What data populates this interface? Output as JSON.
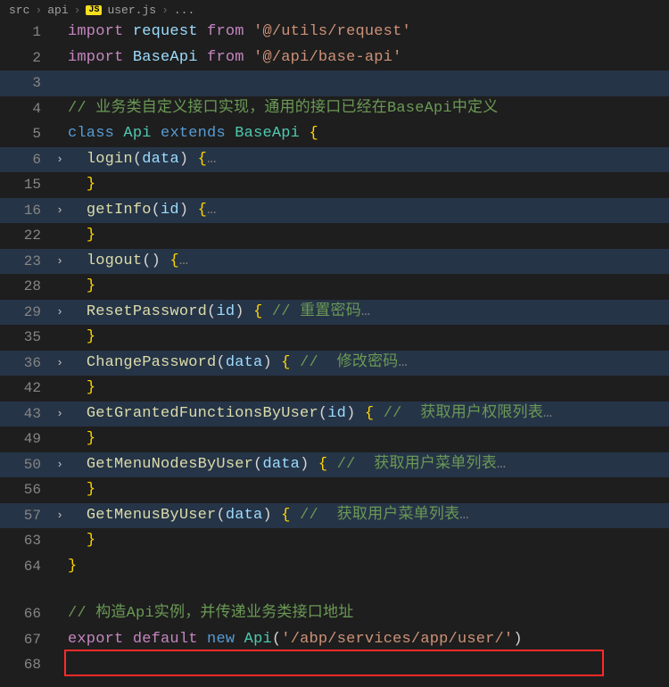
{
  "breadcrumb": {
    "seg1": "src",
    "seg2": "api",
    "file": "user.js",
    "tail": "..."
  },
  "lines": {
    "l1": {
      "num": "1",
      "import": "import",
      "ident": "request",
      "from": "from",
      "str": "'@/utils/request'"
    },
    "l2": {
      "num": "2",
      "import": "import",
      "ident": "BaseApi",
      "from": "from",
      "str": "'@/api/base-api'"
    },
    "l3": {
      "num": "3"
    },
    "l4": {
      "num": "4",
      "comment": "// 业务类自定义接口实现，通用的接口已经在BaseApi中定义"
    },
    "l5": {
      "num": "5",
      "class": "class",
      "name": "Api",
      "extends": "extends",
      "base": "BaseApi",
      "brace": "{"
    },
    "l6": {
      "num": "6",
      "fn": "login",
      "p1": "data",
      "brace": "{",
      "ell": "…"
    },
    "l15": {
      "num": "15",
      "brace": "}"
    },
    "l16": {
      "num": "16",
      "fn": "getInfo",
      "p1": "id",
      "brace": "{",
      "ell": "…"
    },
    "l22": {
      "num": "22",
      "brace": "}"
    },
    "l23": {
      "num": "23",
      "fn": "logout",
      "brace": "{",
      "ell": "…"
    },
    "l28": {
      "num": "28",
      "brace": "}"
    },
    "l29": {
      "num": "29",
      "fn": "ResetPassword",
      "p1": "id",
      "brace": "{",
      "comment": "// 重置密码",
      "ell": "…"
    },
    "l35": {
      "num": "35",
      "brace": "}"
    },
    "l36": {
      "num": "36",
      "fn": "ChangePassword",
      "p1": "data",
      "brace": "{",
      "comment": "//  修改密码",
      "ell": "…"
    },
    "l42": {
      "num": "42",
      "brace": "}"
    },
    "l43": {
      "num": "43",
      "fn": "GetGrantedFunctionsByUser",
      "p1": "id",
      "brace": "{",
      "comment": "//  获取用户权限列表",
      "ell": "…"
    },
    "l49": {
      "num": "49",
      "brace": "}"
    },
    "l50": {
      "num": "50",
      "fn": "GetMenuNodesByUser",
      "p1": "data",
      "brace": "{",
      "comment": "//  获取用户菜单列表",
      "ell": "…"
    },
    "l56": {
      "num": "56",
      "brace": "}"
    },
    "l57": {
      "num": "57",
      "fn": "GetMenusByUser",
      "p1": "data",
      "brace": "{",
      "comment": "//  获取用户菜单列表",
      "ell": "…"
    },
    "l63": {
      "num": "63",
      "brace": "}"
    },
    "l64": {
      "num": "64",
      "brace": "}"
    },
    "l66": {
      "num": "66",
      "comment": "// 构造Api实例，并传递业务类接口地址"
    },
    "l67": {
      "num": "67",
      "export": "export",
      "default": "default",
      "new": "new",
      "ctor": "Api",
      "str": "'/abp/services/app/user/'"
    },
    "l68": {
      "num": "68"
    }
  }
}
